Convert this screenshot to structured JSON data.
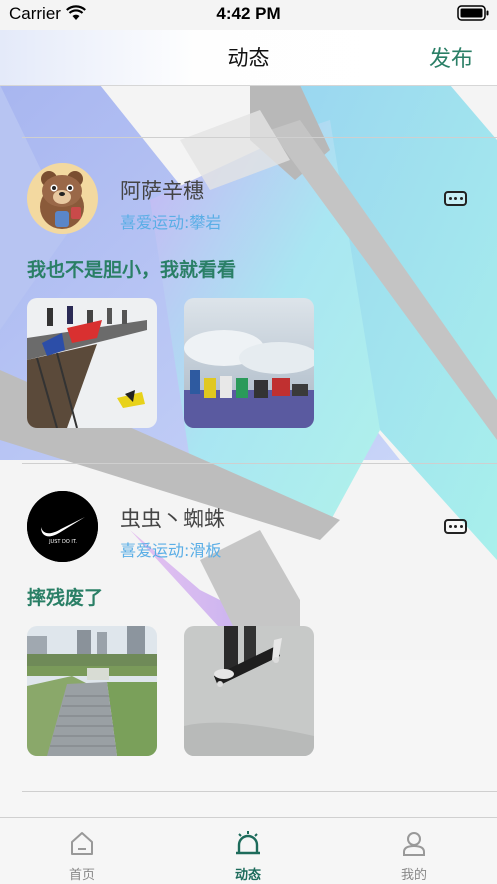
{
  "status_bar": {
    "carrier": "Carrier",
    "time": "4:42 PM"
  },
  "nav": {
    "title": "动态",
    "publish_label": "发布"
  },
  "posts": [
    {
      "username": "阿萨辛穗",
      "hobby": "喜爱运动:攀岩",
      "text": "我也不是胆小，我就看看",
      "photos": [
        "bridge-jump-photo",
        "cliff-edge-photo"
      ]
    },
    {
      "username": "虫虫丶蜘蛛",
      "hobby": "喜爱运动:滑板",
      "text": "摔残废了",
      "photos": [
        "stadium-stairs-photo",
        "skateboard-photo"
      ]
    }
  ],
  "tabs": [
    {
      "label": "首页",
      "icon": "home-icon",
      "active": false
    },
    {
      "label": "动态",
      "icon": "alarm-icon",
      "active": true
    },
    {
      "label": "我的",
      "icon": "person-icon",
      "active": false
    }
  ],
  "colors": {
    "accent": "#2a7f66",
    "hobby": "#5aaee6",
    "tab_active": "#1d6b5b"
  }
}
